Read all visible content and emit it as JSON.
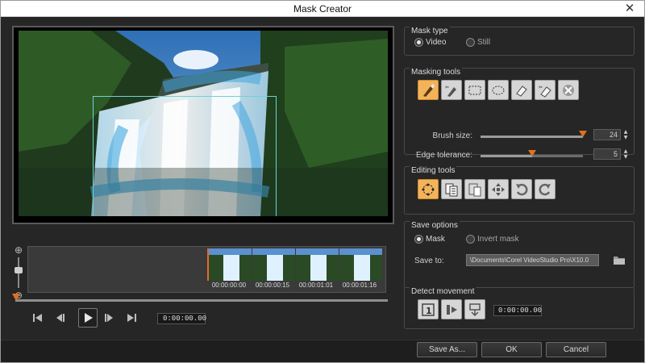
{
  "window": {
    "title": "Mask Creator",
    "close_glyph": "✕"
  },
  "preview": {
    "image": "waterfall-landscape"
  },
  "timeline": {
    "timecodes": [
      "00:00:00:00",
      "00:00:00:15",
      "00:00:01:01",
      "00:00:01:16"
    ]
  },
  "transport": {
    "buttons": [
      "go-to-start",
      "previous-frame",
      "play",
      "next-frame",
      "go-to-end"
    ],
    "timecode": "0:00:00.00"
  },
  "mask_type": {
    "title": "Mask type",
    "options": [
      {
        "label": "Video",
        "selected": true
      },
      {
        "label": "Still",
        "selected": false
      }
    ]
  },
  "masking_tools": {
    "title": "Masking tools",
    "tools": [
      "brush-icon",
      "smart-brush-icon",
      "rectangle-select-icon",
      "ellipse-select-icon",
      "eraser-icon",
      "smart-eraser-icon",
      "clear-mask-icon"
    ],
    "brush_size_label": "Brush size:",
    "brush_size_value": "24",
    "brush_size_level": 1.0,
    "edge_tolerance_label": "Edge tolerance:",
    "edge_tolerance_value": "5",
    "edge_tolerance_level": 0.5
  },
  "editing_tools": {
    "title": "Editing tools",
    "tools": [
      "lasso-icon",
      "copy-frame-icon",
      "paste-frame-icon",
      "move-icon",
      "undo-icon",
      "redo-icon"
    ]
  },
  "save_options": {
    "title": "Save options",
    "options": [
      {
        "label": "Mask",
        "selected": true
      },
      {
        "label": "Invert mask",
        "selected": false
      }
    ],
    "save_to_label": "Save to:",
    "save_to_path": "\\Documents\\Corel VideoStudio Pro\\X10.0"
  },
  "detect_movement": {
    "title": "Detect movement",
    "timecode": "0:00:00.00"
  },
  "buttons": {
    "save_as": "Save As...",
    "ok": "OK",
    "cancel": "Cancel"
  },
  "colors": {
    "accent": "#e07020",
    "active_tool": "#f2b35a",
    "mask_outline": "#6fd2d6"
  }
}
